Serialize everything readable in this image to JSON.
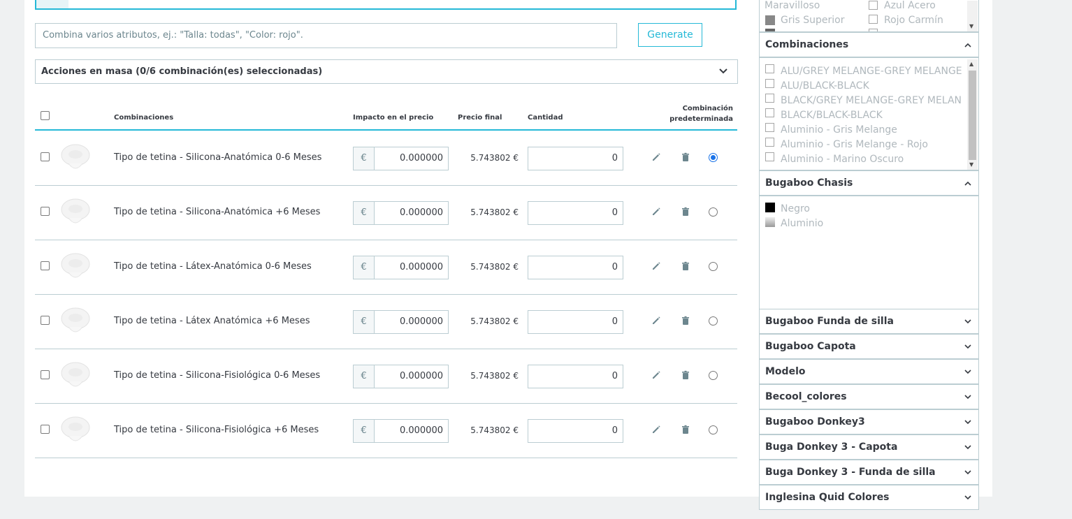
{
  "generator": {
    "input_placeholder": "Combina varios atributos, ej.: \"Talla: todas\", \"Color: rojo\".",
    "button_label": "Generate"
  },
  "bulk_actions": {
    "label": "Acciones en masa (0/6 combinación(es) seleccionadas)"
  },
  "table": {
    "headers": {
      "combinations": "Combinaciones",
      "price_impact": "Impacto en el precio",
      "final_price": "Precio final",
      "quantity": "Cantidad",
      "default_line1": "Combinación",
      "default_line2": "predeterminada"
    },
    "currency": "€",
    "rows": [
      {
        "name": "Tipo de tetina - Silicona-Anatómica 0-6 Meses",
        "impact": "0.000000",
        "final": "5.743802 €",
        "qty": "0",
        "default": true
      },
      {
        "name": "Tipo de tetina - Silicona-Anatómica +6 Meses",
        "impact": "0.000000",
        "final": "5.743802 €",
        "qty": "0",
        "default": false
      },
      {
        "name": "Tipo de tetina - Látex-Anatómica 0-6 Meses",
        "impact": "0.000000",
        "final": "5.743802 €",
        "qty": "0",
        "default": false
      },
      {
        "name": "Tipo de tetina - Látex Anatómica +6 Meses",
        "impact": "0.000000",
        "final": "5.743802 €",
        "qty": "0",
        "default": false
      },
      {
        "name": "Tipo de tetina - Silicona-Fisiológica 0-6 Meses",
        "impact": "0.000000",
        "final": "5.743802 €",
        "qty": "0",
        "default": false
      },
      {
        "name": "Tipo de tetina - Silicona-Fisiológica +6 Meses",
        "impact": "0.000000",
        "final": "5.743802 €",
        "qty": "0",
        "default": false
      }
    ]
  },
  "sidebar": {
    "top_options": [
      {
        "label": "Maravilloso",
        "color": ""
      },
      {
        "label": "Azul Acero",
        "color": ""
      },
      {
        "label": "Gris Superior",
        "color": "#888888"
      },
      {
        "label": "Rojo Carmín",
        "color": ""
      }
    ],
    "combinaciones": {
      "title": "Combinaciones",
      "items": [
        "ALU/GREY MELANGE-GREY MELANGE",
        "ALU/BLACK-BLACK",
        "BLACK/GREY MELANGE-GREY MELAN",
        "BLACK/BLACK-BLACK",
        "Aluminio - Gris Melange",
        "Aluminio - Gris Melange - Rojo",
        "Aluminio - Marino Oscuro"
      ]
    },
    "chasis": {
      "title": "Bugaboo Chasis",
      "items": [
        {
          "label": "Negro",
          "color": "#000000"
        },
        {
          "label": "Aluminio",
          "color": "#c8c8c8"
        }
      ]
    },
    "collapsed": [
      "Bugaboo Funda de silla",
      "Bugaboo Capota",
      "Modelo",
      "Becool_colores",
      "Bugaboo Donkey3",
      "Buga Donkey 3 - Capota",
      "Buga Donkey 3 - Funda de silla",
      "Inglesina Quid Colores"
    ]
  },
  "colors": {
    "accent": "#25b9d7",
    "border": "#bbcdd2",
    "radio_active": "#1a73e8"
  }
}
